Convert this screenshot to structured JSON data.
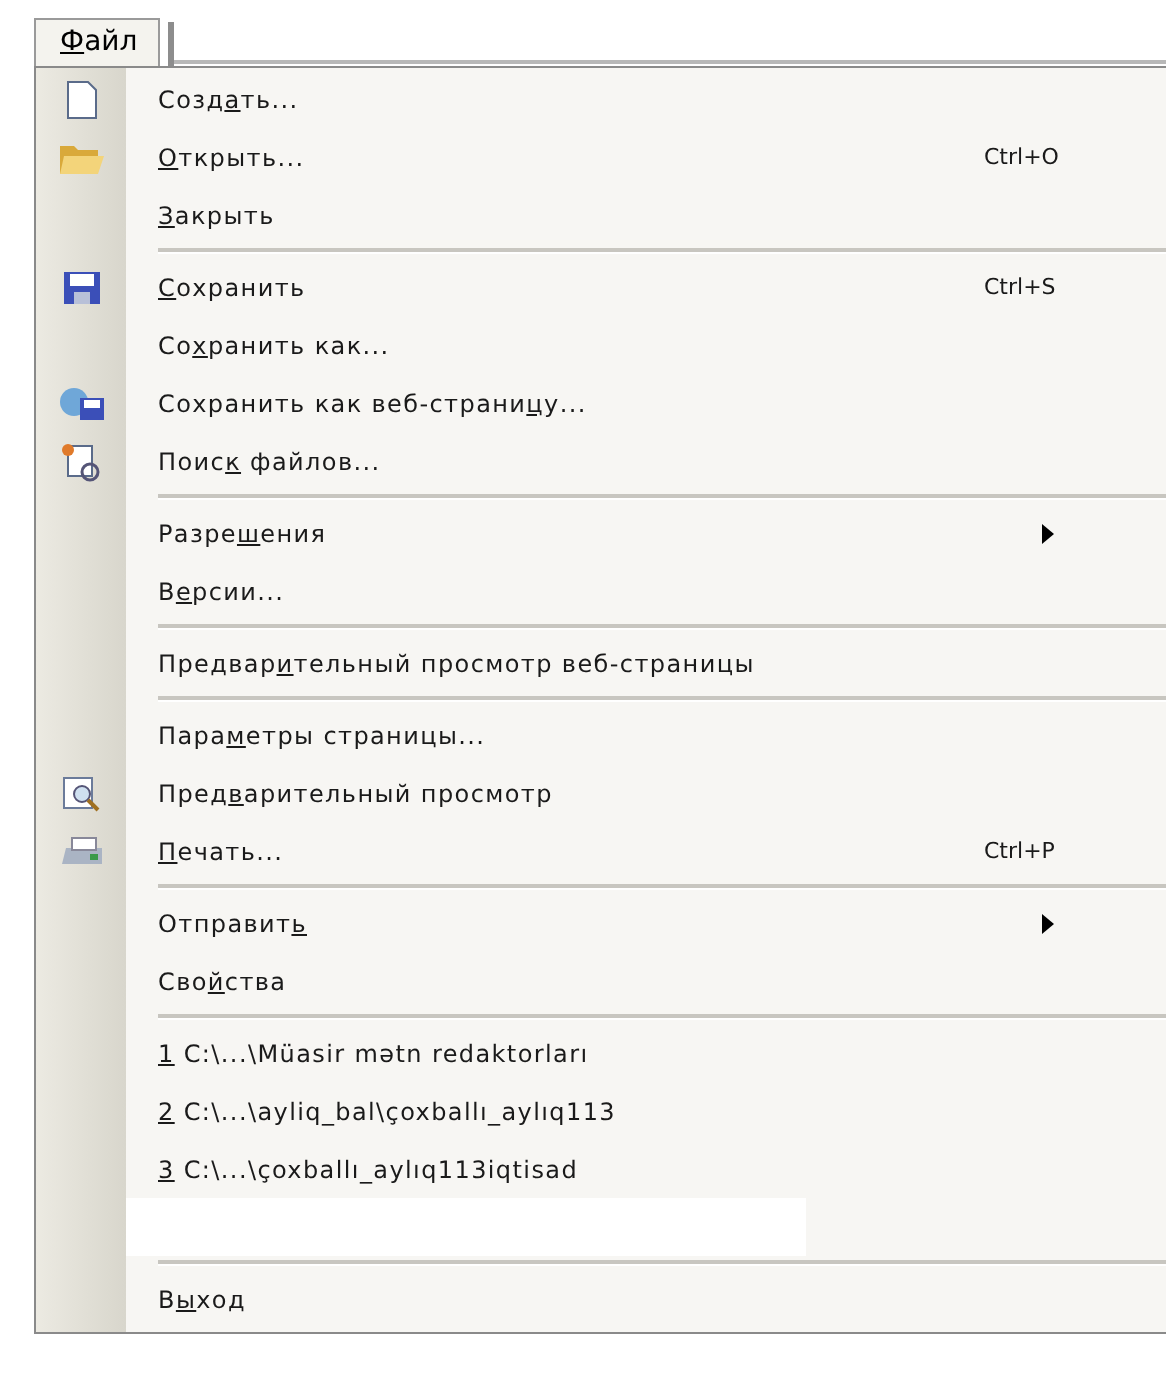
{
  "menu_bar": {
    "items": [
      {
        "label": [
          {
            "text": "Ф",
            "underlined": true
          },
          {
            "text": "айл",
            "underlined": false
          }
        ],
        "selected": true
      }
    ]
  },
  "menu": {
    "sections": [
      {
        "kind": "plain",
        "items": [
          {
            "label": [
              {
                "text": "Созд",
                "underlined": false
              },
              {
                "text": "а",
                "underlined": true
              },
              {
                "text": "ть...",
                "underlined": false
              }
            ],
            "submenu": false
          },
          {
            "label": [
              {
                "text": "О",
                "underlined": true
              },
              {
                "text": "ткрыть...",
                "underlined": false
              }
            ],
            "shortcut": "Ctrl+O",
            "submenu": false
          },
          {
            "label": [
              {
                "text": "З",
                "underlined": true
              },
              {
                "text": "акрыть",
                "underlined": false
              }
            ],
            "submenu": false
          }
        ]
      },
      {
        "kind": "plain",
        "items": [
          {
            "label": [
              {
                "text": "С",
                "underlined": true
              },
              {
                "text": "охранить",
                "underlined": false
              }
            ],
            "shortcut": "Ctrl+S",
            "submenu": false
          },
          {
            "label": [
              {
                "text": "Со",
                "underlined": false
              },
              {
                "text": "х",
                "underlined": true
              },
              {
                "text": "ранить как...",
                "underlined": false
              }
            ],
            "submenu": false
          },
          {
            "label": [
              {
                "text": "Сохранить как веб-страни",
                "underlined": false
              },
              {
                "text": "ц",
                "underlined": true
              },
              {
                "text": "у...",
                "underlined": false
              }
            ],
            "submenu": false
          },
          {
            "label": [
              {
                "text": "Поис",
                "underlined": false
              },
              {
                "text": "к",
                "underlined": true
              },
              {
                "text": " файлов...",
                "underlined": false
              }
            ],
            "submenu": false
          }
        ]
      },
      {
        "kind": "plain",
        "items": [
          {
            "label": [
              {
                "text": "Разре",
                "underlined": false
              },
              {
                "text": "ш",
                "underlined": true
              },
              {
                "text": "ения",
                "underlined": false
              }
            ],
            "submenu": true
          },
          {
            "label": [
              {
                "text": "В",
                "underlined": false
              },
              {
                "text": "е",
                "underlined": true
              },
              {
                "text": "рсии...",
                "underlined": false
              }
            ],
            "submenu": false
          }
        ]
      },
      {
        "kind": "plain",
        "items": [
          {
            "label": [
              {
                "text": "Предвар",
                "underlined": false
              },
              {
                "text": "и",
                "underlined": true
              },
              {
                "text": "тельный просмотр веб-страницы",
                "underlined": false
              }
            ],
            "submenu": false
          }
        ]
      },
      {
        "kind": "plain",
        "items": [
          {
            "label": [
              {
                "text": "Пара",
                "underlined": false
              },
              {
                "text": "м",
                "underlined": true
              },
              {
                "text": "етры страницы...",
                "underlined": false
              }
            ],
            "submenu": false
          },
          {
            "label": [
              {
                "text": "Пред",
                "underlined": false
              },
              {
                "text": "в",
                "underlined": true
              },
              {
                "text": "арительный просмотр",
                "underlined": false
              }
            ],
            "submenu": false
          },
          {
            "label": [
              {
                "text": "П",
                "underlined": true
              },
              {
                "text": "ечать...",
                "underlined": false
              }
            ],
            "shortcut": "Ctrl+P",
            "submenu": false
          }
        ]
      },
      {
        "kind": "plain",
        "items": [
          {
            "label": [
              {
                "text": "Отправит",
                "underlined": false
              },
              {
                "text": "ь",
                "underlined": true
              }
            ],
            "submenu": true
          },
          {
            "label": [
              {
                "text": "Сво",
                "underlined": false
              },
              {
                "text": "й",
                "underlined": true
              },
              {
                "text": "ства",
                "underlined": false
              }
            ],
            "submenu": false
          }
        ]
      },
      {
        "kind": "recent",
        "items": [
          {
            "label": [
              {
                "text": "1",
                "underlined": true
              },
              {
                "text": " C:\\...\\Müasir mətn redaktorları",
                "underlined": false
              }
            ],
            "submenu": false
          },
          {
            "label": [
              {
                "text": "2",
                "underlined": true
              },
              {
                "text": " C:\\...\\ayliq_bal\\çoxballı_aylıq113",
                "underlined": false
              }
            ],
            "submenu": false
          },
          {
            "label": [
              {
                "text": "3",
                "underlined": true
              },
              {
                "text": " C:\\...\\çoxballı_aylıq113iqtisad",
                "underlined": false
              }
            ],
            "submenu": false
          }
        ]
      },
      {
        "kind": "plain",
        "items": [
          {
            "label": [
              {
                "text": "В",
                "underlined": false
              },
              {
                "text": "ы",
                "underlined": true
              },
              {
                "text": "ход",
                "underlined": false
              }
            ],
            "submenu": false
          }
        ]
      }
    ]
  }
}
